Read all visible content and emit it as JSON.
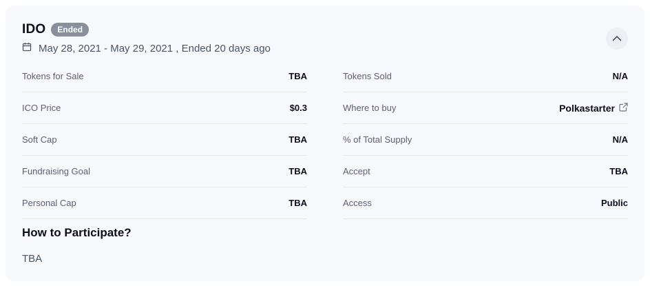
{
  "header": {
    "title": "IDO",
    "status_badge": "Ended",
    "calendar_icon": "calendar-icon",
    "date_range": "May 28, 2021 - May 29, 2021 , Ended 20 days ago",
    "collapse_icon": "chevron-up-icon"
  },
  "details": {
    "left": [
      {
        "label": "Tokens for Sale",
        "value": "TBA"
      },
      {
        "label": "ICO Price",
        "value": "$0.3"
      },
      {
        "label": "Soft Cap",
        "value": "TBA"
      },
      {
        "label": "Fundraising Goal",
        "value": "TBA"
      },
      {
        "label": "Personal Cap",
        "value": "TBA"
      }
    ],
    "right": [
      {
        "label": "Tokens Sold",
        "value": "N/A"
      },
      {
        "label": "Where to buy",
        "value": "Polkastarter",
        "icon": "external-link-icon"
      },
      {
        "label": "% of Total Supply",
        "value": "N/A"
      },
      {
        "label": "Accept",
        "value": "TBA"
      },
      {
        "label": "Access",
        "value": "Public"
      }
    ]
  },
  "participate": {
    "heading": "How to Participate?",
    "body": "TBA"
  },
  "colors": {
    "card_bg": "#f7f8fc",
    "badge_bg": "#8a8f9c",
    "divider": "#e6e8ee"
  }
}
